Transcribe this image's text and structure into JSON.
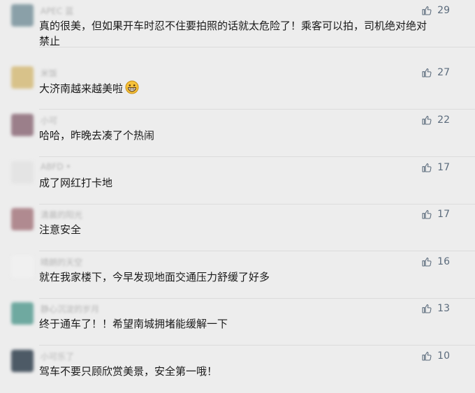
{
  "colors": {
    "background": "#ededed",
    "text": "#1a1a1a",
    "nickname": "#b5b5b5",
    "like": "#5b6b7c",
    "divider": "#dcdcdc"
  },
  "comments": [
    {
      "nickname": "APEC 蓝",
      "text": "真的很美，但如果开车时忍不住要拍照的话就太危险了！乘客可以拍，司机绝对绝对禁止",
      "likes": "29",
      "avatar_color": "#8aa0a8"
    },
    {
      "nickname": "米饭",
      "text": "大济南越来越美啦",
      "likes": "27",
      "avatar_color": "#d8c28a",
      "emoji": "grinning-emoji"
    },
    {
      "nickname": "小可",
      "text": "哈哈，昨晚去凑了个热闹",
      "likes": "22",
      "avatar_color": "#9b7f8a"
    },
    {
      "nickname": "ABFD •",
      "text": "成了网红打卡地",
      "likes": "17",
      "avatar_color": "#e4e4e4"
    },
    {
      "nickname": "清晨的阳光",
      "text": "注意安全",
      "likes": "17",
      "avatar_color": "#b08a90"
    },
    {
      "nickname": "晴朗的天空",
      "text": "就在我家楼下，今早发现地面交通压力舒缓了好多",
      "likes": "16",
      "avatar_color": "#f0f0f0"
    },
    {
      "nickname": "静心沉淀的岁月",
      "text": "终于通车了！！希望南城拥堵能缓解一下",
      "likes": "13",
      "avatar_color": "#6fa9a0"
    },
    {
      "nickname": "小可乐了",
      "text": "驾车不要只顾欣赏美景，安全第一哦！",
      "likes": "10",
      "avatar_color": "#4d5a66"
    }
  ]
}
